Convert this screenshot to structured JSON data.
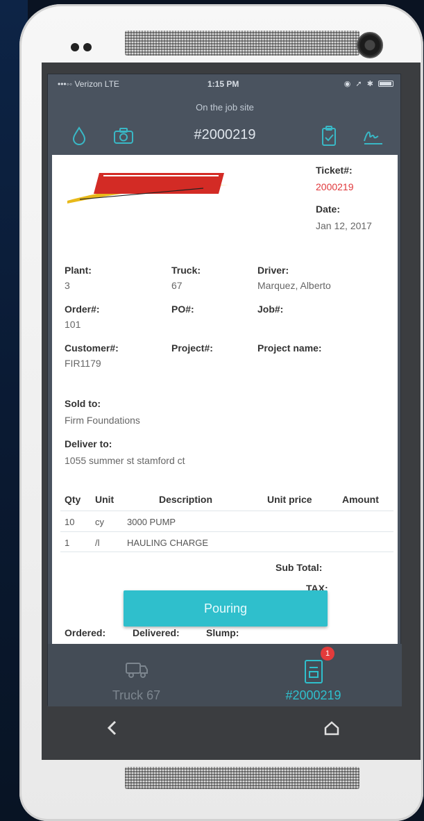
{
  "status_bar": {
    "carrier": "•••◦◦ Verizon  LTE",
    "time": "1:15 PM",
    "right_icons": "◉ ➚ ✱"
  },
  "header": {
    "subtitle": "On the job site",
    "ticket_title": "#2000219"
  },
  "ticket": {
    "ticket_label": "Ticket#:",
    "ticket_value": "2000219",
    "date_label": "Date:",
    "date_value": "Jan 12, 2017",
    "plant_label": "Plant:",
    "plant_value": "3",
    "truck_label": "Truck:",
    "truck_value": "67",
    "driver_label": "Driver:",
    "driver_value": "Marquez, Alberto",
    "order_label": "Order#:",
    "order_value": "101",
    "po_label": "PO#:",
    "job_label": "Job#:",
    "customer_label": "Customer#:",
    "customer_value": "FIR1179",
    "project_label": "Project#:",
    "project_name_label": "Project name:",
    "sold_to_label": "Sold to:",
    "sold_to_value": "Firm Foundations",
    "deliver_to_label": "Deliver to:",
    "deliver_to_value": "1055 summer st stamford ct"
  },
  "table": {
    "headers": [
      "Qty",
      "Unit",
      "Description",
      "Unit price",
      "Amount"
    ],
    "rows": [
      [
        "10",
        "cy",
        "3000 PUMP"
      ],
      [
        "1",
        "/l",
        "HAULING CHARGE"
      ]
    ]
  },
  "totals": {
    "subtotal_label": "Sub Total:",
    "tax_label": "TAX:",
    "total_label": ":"
  },
  "footer_fields": {
    "ordered_label": "Ordered:",
    "delivered_label": "Delivered:",
    "slump_label": "Slump:"
  },
  "action": {
    "pouring_label": "Pouring"
  },
  "tabs": {
    "truck_label": "Truck 67",
    "ticket_label": "#2000219",
    "badge_count": "1"
  },
  "colors": {
    "accent": "#2fbfcc",
    "ticket_red": "#e0383b",
    "header_bg": "#4a535f"
  }
}
